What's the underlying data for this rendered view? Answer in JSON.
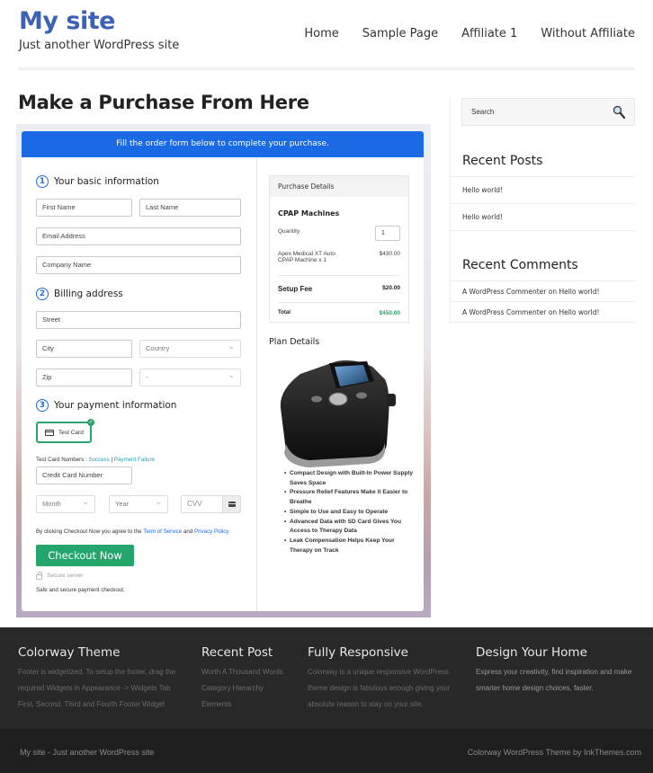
{
  "site": {
    "title": "My site",
    "tagline": "Just another WordPress site"
  },
  "nav": {
    "items": [
      "Home",
      "Sample Page",
      "Affiliate 1",
      "Without Affiliate"
    ]
  },
  "page": {
    "title": "Make a Purchase From Here"
  },
  "checkout": {
    "banner": "Fill the order form below to complete your purchase.",
    "sections": {
      "basic": {
        "num": "1",
        "label": "Your basic information"
      },
      "billing": {
        "num": "2",
        "label": "Billing address"
      },
      "payment": {
        "num": "3",
        "label": "Your payment information"
      }
    },
    "fields": {
      "first_name": "First Name",
      "last_name": "Last Name",
      "email": "Email Address",
      "company": "Company Name",
      "street": "Street",
      "city": "City",
      "country": "Country",
      "zip": "Zip",
      "state": "-",
      "card_number": "Credit Card Number",
      "month": "Month",
      "year": "Year",
      "cvv": "CVV"
    },
    "test_card_label": "Test Card",
    "test_numbers_prefix": "Test Card Numbers : ",
    "test_success": "Success",
    "test_sep": " | ",
    "test_failure": "Payment Failure",
    "terms_prefix": "By clicking Checkout Now you agree to the ",
    "terms_link": "Term of Service",
    "terms_and": " and ",
    "privacy_link": "Privacy Policy",
    "checkout_button": "Checkout Now",
    "secure_server": "Secure server",
    "secure_note": "Safe and secure payment checkout.",
    "colors": {
      "banner": "#1a6ae6",
      "button": "#24a56c",
      "total": "#2aa46a"
    }
  },
  "purchase": {
    "header": "Purchase Details",
    "product_group": "CPAP Machines",
    "quantity_label": "Quantity",
    "quantity_value": "1",
    "item_name_line1": "Apex Medical XT Auto",
    "item_name_line2": "CPAP Machine x 1",
    "item_price": "$430.00",
    "setup_label": "Setup Fee",
    "setup_price": "$20.00",
    "total_label": "Total",
    "total_price": "$450.00"
  },
  "plan": {
    "title": "Plan Details",
    "features": [
      "Compact Design with Built-In Power Supply Saves Space",
      "Pressure Relief Features Make it Easier to Breathe",
      "Simple to Use and Easy to Operate",
      "Advanced Data with SD Card Gives You Access to Therapy Data",
      "Leak Compensation Helps Keep Your Therapy on Track"
    ]
  },
  "sidebar": {
    "search_placeholder": "Search",
    "recent_posts_title": "Recent Posts",
    "recent_posts": [
      "Hello world!",
      "Hello world!"
    ],
    "recent_comments_title": "Recent Comments",
    "recent_comments": [
      "A WordPress Commenter on Hello world!",
      "A WordPress Commenter on Hello world!"
    ]
  },
  "footer": {
    "cols": [
      {
        "title": "Colorway Theme",
        "lines": [
          "Footer is widgetized. To setup the footer, drag the",
          "required Widgets in Appearance -> Widgets Tab",
          "First, Second, Third and Fourth Footer Widget"
        ]
      },
      {
        "title": "Recent Post",
        "lines": [
          "Worth A Thousand Words",
          "Category Hierarchy",
          "Elements"
        ]
      },
      {
        "title": "Fully Responsive",
        "lines": [
          "Colorway is a unique responsive WordPress",
          "theme design is fabulous enough giving your",
          "absolute reason to stay on your site."
        ]
      },
      {
        "title": "Design Your Home",
        "lines": [
          "Express your creativity, find inspiration and make",
          "smarter home design choices, faster."
        ]
      }
    ],
    "bottom_left": "My site - Just another WordPress site",
    "bottom_right": "Colorway WordPress Theme by InkThemes.com"
  }
}
